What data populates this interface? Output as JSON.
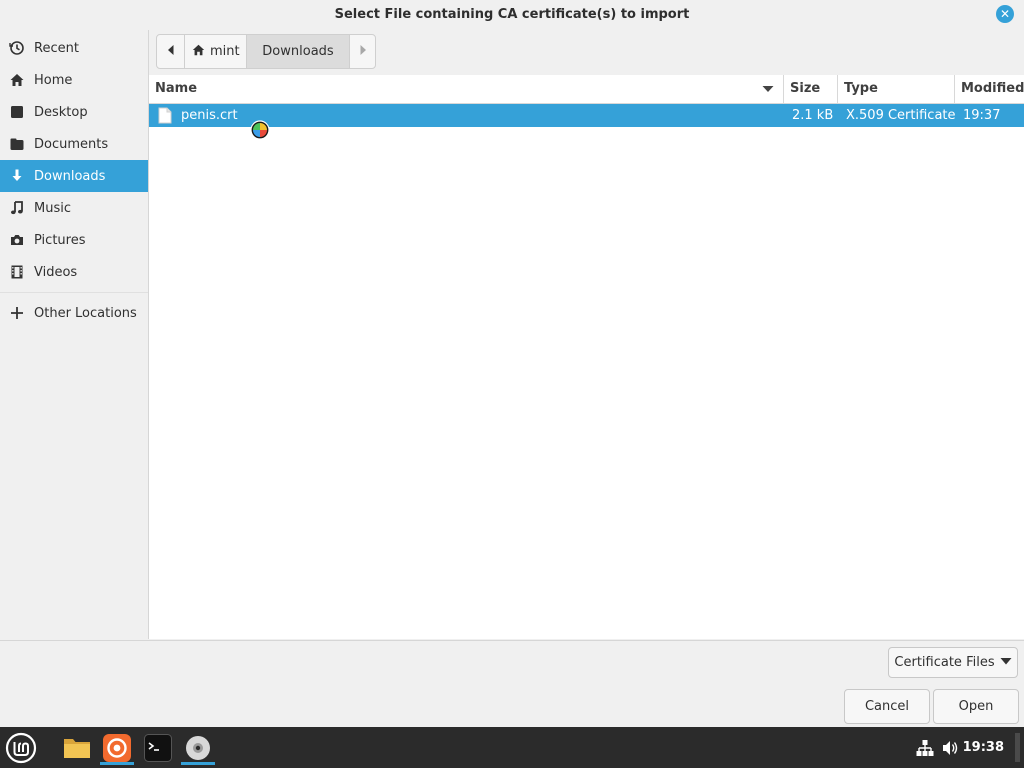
{
  "window": {
    "title": "Select File containing CA certificate(s) to import"
  },
  "sidebar": {
    "items": [
      {
        "label": "Recent",
        "icon": "clock-icon"
      },
      {
        "label": "Home",
        "icon": "home-icon"
      },
      {
        "label": "Desktop",
        "icon": "desktop-icon"
      },
      {
        "label": "Documents",
        "icon": "documents-icon"
      },
      {
        "label": "Downloads",
        "icon": "download-arrow-icon",
        "active": true
      },
      {
        "label": "Music",
        "icon": "music-note-icon"
      },
      {
        "label": "Pictures",
        "icon": "camera-icon"
      },
      {
        "label": "Videos",
        "icon": "film-icon"
      }
    ],
    "other": {
      "label": "Other Locations",
      "icon": "plus-icon"
    }
  },
  "pathbar": {
    "home_label": "mint",
    "current_label": "Downloads"
  },
  "columns": {
    "name": "Name",
    "size": "Size",
    "type": "Type",
    "modified": "Modified"
  },
  "files": [
    {
      "name": "penis.crt",
      "size": "2.1 kB",
      "type": "X.509 Certificate",
      "modified": "19:37",
      "selected": true
    }
  ],
  "filter": {
    "label": "Certificate Files"
  },
  "actions": {
    "cancel": "Cancel",
    "open": "Open"
  },
  "taskbar": {
    "clock": "19:38"
  },
  "colors": {
    "accent": "#35a1d8",
    "taskbar": "#2b2b2b"
  }
}
